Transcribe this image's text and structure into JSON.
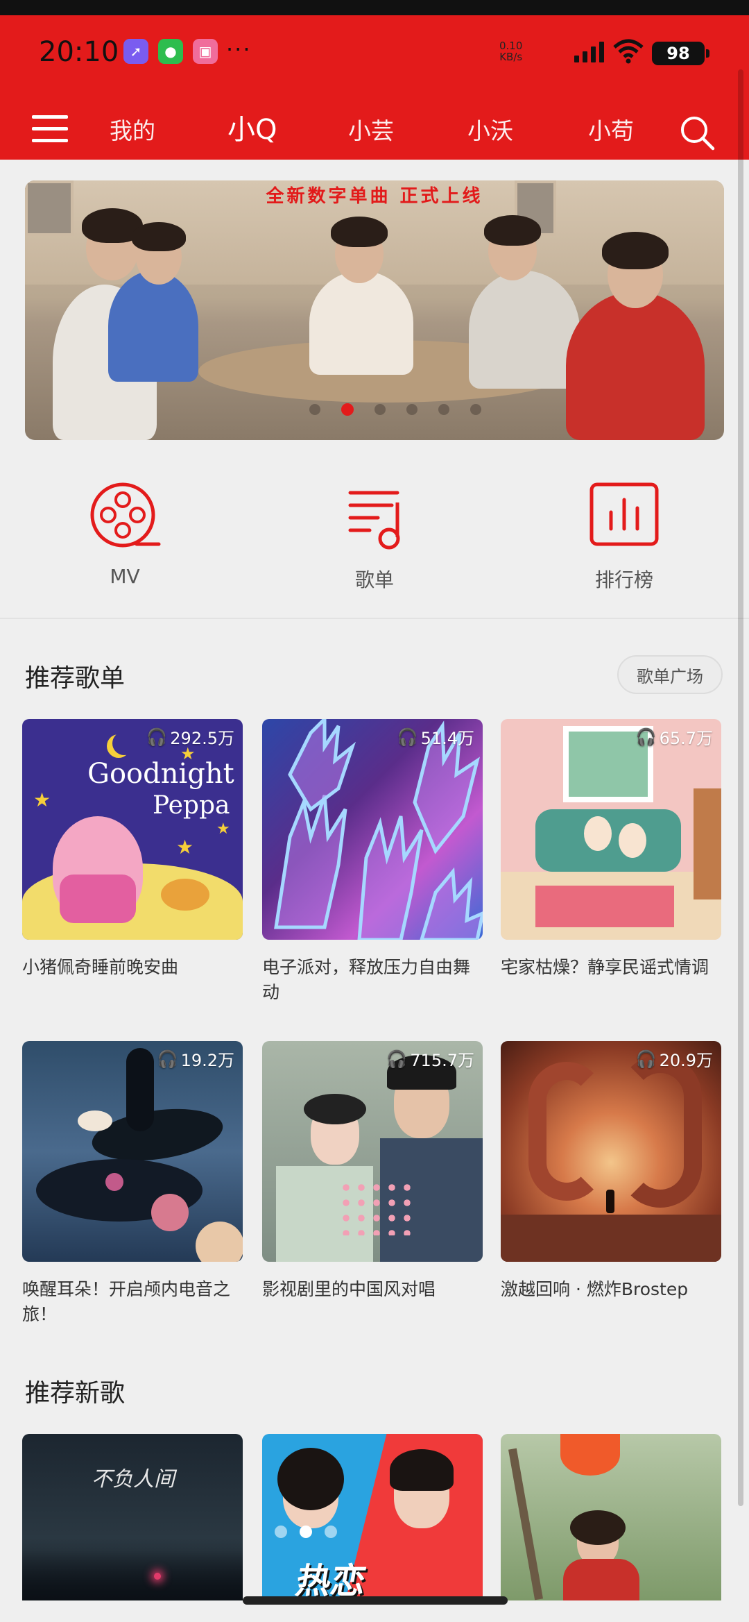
{
  "status_bar": {
    "time": "20:10",
    "net_speed_value": "0.10",
    "net_speed_unit": "KB/s",
    "battery": "98",
    "app_icons": [
      "rocket-icon",
      "wechat-icon",
      "bilibili-icon"
    ],
    "more": "···"
  },
  "nav": {
    "tabs": [
      {
        "label": "我的",
        "active": false
      },
      {
        "label": "小Q",
        "active": true
      },
      {
        "label": "小芸",
        "active": false
      },
      {
        "label": "小沃",
        "active": false
      },
      {
        "label": "小苟",
        "active": false
      }
    ]
  },
  "banner": {
    "headline": "全新数字单曲  正式上线",
    "slide_count": 6,
    "active_slide": 2
  },
  "quick_access": [
    {
      "label": "MV",
      "icon": "film-reel-icon"
    },
    {
      "label": "歌单",
      "icon": "playlist-note-icon"
    },
    {
      "label": "排行榜",
      "icon": "chart-bars-icon"
    }
  ],
  "recommended_playlists": {
    "title": "推荐歌单",
    "plaza_button": "歌单广场",
    "items": [
      {
        "title": "小猪佩奇睡前晚安曲",
        "plays": "292.5万",
        "cover_text_1": "Goodnight",
        "cover_text_2": "Peppa"
      },
      {
        "title": "电子派对，释放压力自由舞动",
        "plays": "51.4万"
      },
      {
        "title": "宅家枯燥？静享民谣式情调",
        "plays": "65.7万"
      },
      {
        "title": "唤醒耳朵！开启颅内电音之旅！",
        "plays": "19.2万"
      },
      {
        "title": "影视剧里的中国风对唱",
        "plays": "715.7万"
      },
      {
        "title": "激越回响 · 燃炸Brostep",
        "plays": "20.9万"
      }
    ]
  },
  "recommended_songs": {
    "title": "推荐新歌",
    "cover_text_1": "不负人间",
    "cover_text_2": "热恋"
  },
  "colors": {
    "brand_red": "#e31b1b",
    "background": "#efefef"
  }
}
